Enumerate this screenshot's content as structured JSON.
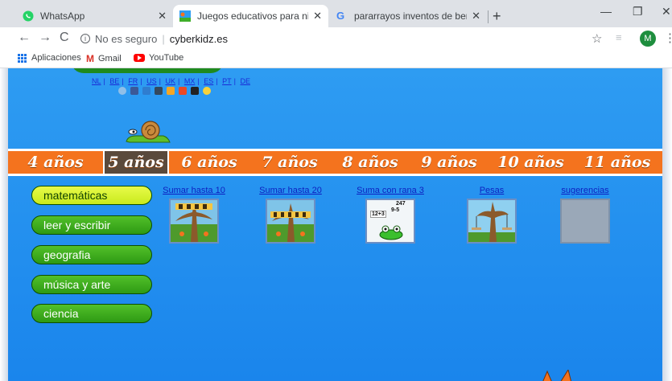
{
  "browser": {
    "tabs": [
      {
        "title": "WhatsApp",
        "active": false
      },
      {
        "title": "Juegos educativos para niños. M",
        "active": true
      },
      {
        "title": "pararrayos inventos de benjamin",
        "active": false
      }
    ],
    "address": {
      "security": "No es seguro",
      "url": "cyberkidz.es"
    },
    "profile_initial": "M",
    "bookmarks": [
      "Aplicaciones",
      "Gmail",
      "YouTube"
    ]
  },
  "site": {
    "languages": [
      "NL",
      "BE",
      "FR",
      "US",
      "UK",
      "MX",
      "ES",
      "PT",
      "DE"
    ],
    "ages": [
      {
        "label": "4 años",
        "active": false
      },
      {
        "label": "5 años",
        "active": true
      },
      {
        "label": "6 años",
        "active": false
      },
      {
        "label": "7 años",
        "active": false
      },
      {
        "label": "8 años",
        "active": false
      },
      {
        "label": "9 años",
        "active": false
      },
      {
        "label": "10 años",
        "active": false
      },
      {
        "label": "11 años",
        "active": false
      }
    ],
    "subjects": [
      {
        "label": "matemáticas",
        "active": true
      },
      {
        "label": "leer y escribir",
        "active": false
      },
      {
        "label": "geografia",
        "active": false
      },
      {
        "label": "música y arte",
        "active": false
      },
      {
        "label": "ciencia",
        "active": false
      }
    ],
    "games": [
      {
        "title": "Sumar hasta 10"
      },
      {
        "title": "Sumar hasta 20"
      },
      {
        "title": "Suma con rana 3"
      },
      {
        "title": "Pesas"
      },
      {
        "title": "sugerencias"
      }
    ],
    "frog_game_text": {
      "top": "247",
      "mid": "9-5",
      "eq": "12+3"
    }
  }
}
